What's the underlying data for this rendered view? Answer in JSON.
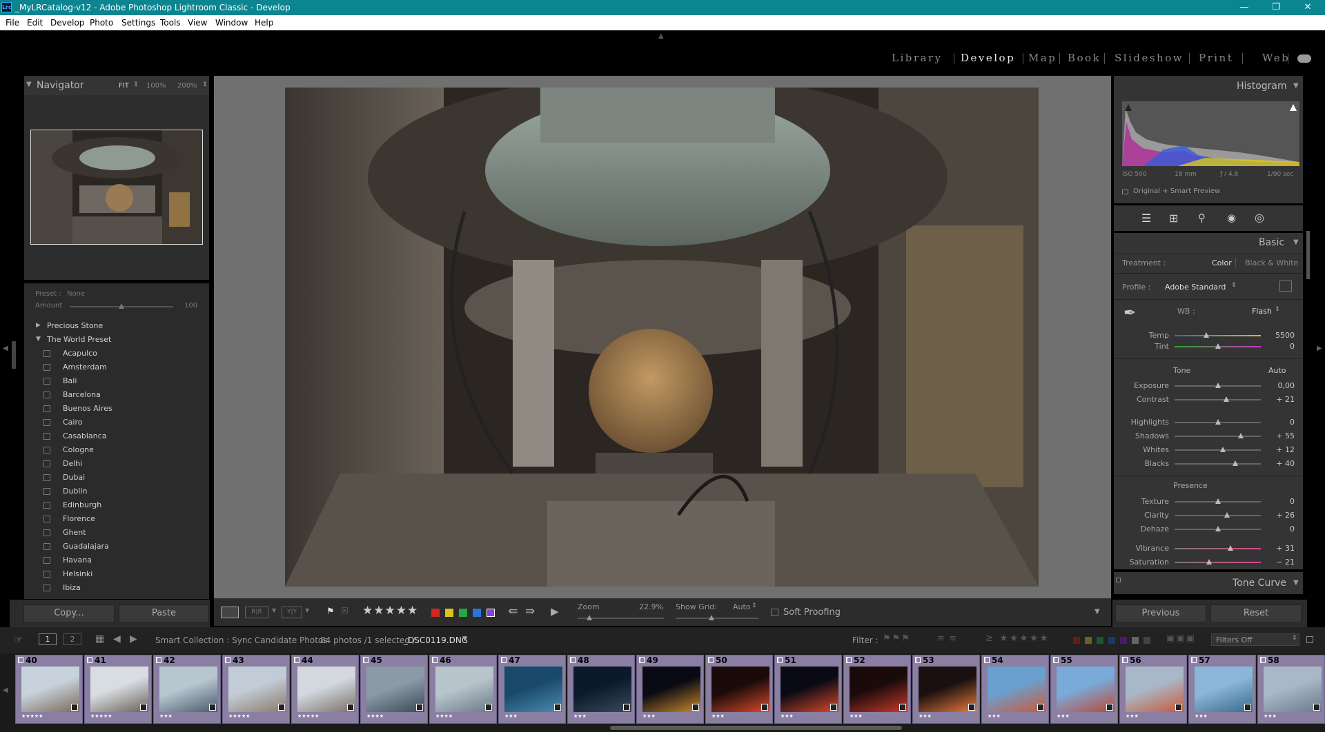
{
  "window": {
    "title": "_MyLRCatalog-v12 - Adobe Photoshop Lightroom Classic - Develop",
    "app_icon": "Lrc"
  },
  "menu": [
    "File",
    "Edit",
    "Develop",
    "Photo",
    "Settings",
    "Tools",
    "View",
    "Window",
    "Help"
  ],
  "modules": [
    "Library",
    "Develop",
    "Map",
    "Book",
    "Slideshow",
    "Print",
    "Web"
  ],
  "active_module": "Develop",
  "navigator": {
    "title": "Navigator",
    "zoom_options": [
      "FIT",
      "100%",
      "200%"
    ]
  },
  "preset_amount": {
    "preset_label": "Preset :",
    "preset_value": "None",
    "amount_label": "Amount",
    "amount_value": "100",
    "amount_level": 0.5
  },
  "presets": {
    "collapsed_group": "Precious Stone",
    "open_group": "The World Preset",
    "items": [
      "Acapulco",
      "Amsterdam",
      "Bali",
      "Barcelona",
      "Buenos Aires",
      "Cairo",
      "Casablanca",
      "Cologne",
      "Delhi",
      "Dubai",
      "Dublin",
      "Edinburgh",
      "Florence",
      "Ghent",
      "Guadalajara",
      "Havana",
      "Helsinki",
      "Ibiza"
    ]
  },
  "left_buttons": {
    "copy": "Copy...",
    "paste": "Paste"
  },
  "histogram": {
    "title": "Histogram",
    "iso": "ISO 500",
    "focal": "18 mm",
    "aperture": "ƒ / 4.8",
    "shutter": "1/90 sec",
    "preview": "Original + Smart Preview"
  },
  "basic": {
    "title": "Basic",
    "treatment_label": "Treatment :",
    "treatment_color": "Color",
    "treatment_bw": "Black & White",
    "profile_label": "Profile :",
    "profile_value": "Adobe Standard",
    "wb_label": "WB :",
    "wb_value": "Flash",
    "temp": {
      "label": "Temp",
      "value": "5500",
      "level": 0.37
    },
    "tint": {
      "label": "Tint",
      "value": "0",
      "level": 0.5
    },
    "tone_label": "Tone",
    "auto_label": "Auto",
    "tone": [
      {
        "label": "Exposure",
        "value": "0,00",
        "level": 0.5
      },
      {
        "label": "Contrast",
        "value": "+ 21",
        "level": 0.6
      },
      {
        "label": "Highlights",
        "value": "0",
        "level": 0.5
      },
      {
        "label": "Shadows",
        "value": "+ 55",
        "level": 0.77
      },
      {
        "label": "Whites",
        "value": "+ 12",
        "level": 0.56
      },
      {
        "label": "Blacks",
        "value": "+ 40",
        "level": 0.7
      }
    ],
    "presence_label": "Presence",
    "presence": [
      {
        "label": "Texture",
        "value": "0",
        "level": 0.5
      },
      {
        "label": "Clarity",
        "value": "+ 26",
        "level": 0.61
      },
      {
        "label": "Dehaze",
        "value": "0",
        "level": 0.5
      },
      {
        "label": "Vibrance",
        "value": "+ 31",
        "level": 0.65
      },
      {
        "label": "Saturation",
        "value": "− 21",
        "level": 0.4
      }
    ]
  },
  "tone_curve": {
    "title": "Tone Curve"
  },
  "right_buttons": {
    "previous": "Previous",
    "reset": "Reset"
  },
  "toolbar": {
    "zoom_label": "Zoom",
    "zoom_value": "22.9%",
    "show_grid_label": "Show Grid:",
    "show_grid_value": "Auto",
    "soft_proofing": "Soft Proofing"
  },
  "filmstrip_header": {
    "view1": "1",
    "view2": "2",
    "source": "Smart Collection : Sync Candidate Photos",
    "count": "84 photos /1 selected /",
    "filename": "_DSC0119.DNG",
    "filter_label": "Filter :",
    "filters_value": "Filters Off"
  },
  "filmstrip": [
    {
      "num": "40",
      "stars": "★★★★★"
    },
    {
      "num": "41",
      "stars": "★★★★★"
    },
    {
      "num": "42",
      "stars": "★★★"
    },
    {
      "num": "43",
      "stars": "★★★★★"
    },
    {
      "num": "44",
      "stars": "★★★★★"
    },
    {
      "num": "45",
      "stars": "★★★★"
    },
    {
      "num": "46",
      "stars": "★★★★"
    },
    {
      "num": "47",
      "stars": "★★★"
    },
    {
      "num": "48",
      "stars": "★★★"
    },
    {
      "num": "49",
      "stars": "★★★"
    },
    {
      "num": "50",
      "stars": "★★★"
    },
    {
      "num": "51",
      "stars": "★★★"
    },
    {
      "num": "52",
      "stars": "★★★"
    },
    {
      "num": "53",
      "stars": "★★★"
    },
    {
      "num": "54",
      "stars": "★★★"
    },
    {
      "num": "55",
      "stars": "★★★"
    },
    {
      "num": "56",
      "stars": "★★★"
    },
    {
      "num": "57",
      "stars": "★★★"
    },
    {
      "num": "58",
      "stars": "★★★"
    }
  ],
  "colors": {
    "titlebar": "#0b8690",
    "panel": "#343434",
    "center_bg": "#707070",
    "film_cell": "#8a7fa3"
  }
}
